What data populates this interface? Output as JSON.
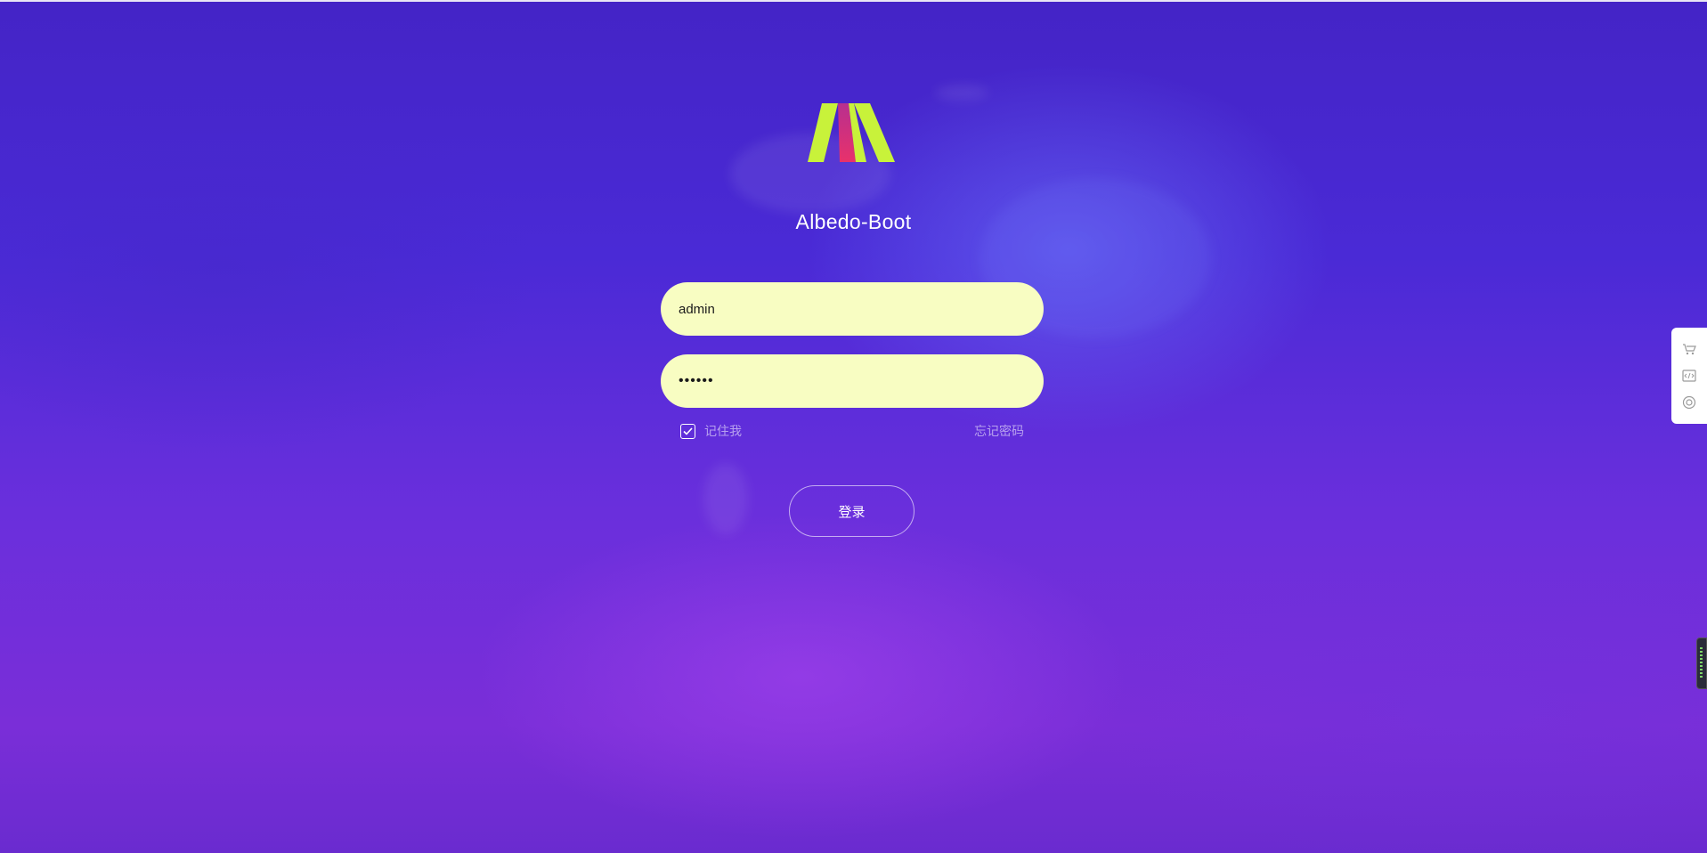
{
  "app": {
    "title": "Albedo-Boot"
  },
  "login_form": {
    "username_value": "admin",
    "password_value": "••••••",
    "remember_me_label": "记住我",
    "remember_me_checked": true,
    "forgot_password_label": "忘记密码",
    "login_button_label": "登录"
  },
  "side_toolbar": {
    "icons": [
      "cart-icon",
      "code-icon",
      "help-icon"
    ]
  },
  "colors": {
    "input_background": "#f8fdc2",
    "logo_green": "#c8f23a",
    "logo_pink": "#e8316b",
    "background_primary": "#4a2ad6"
  }
}
